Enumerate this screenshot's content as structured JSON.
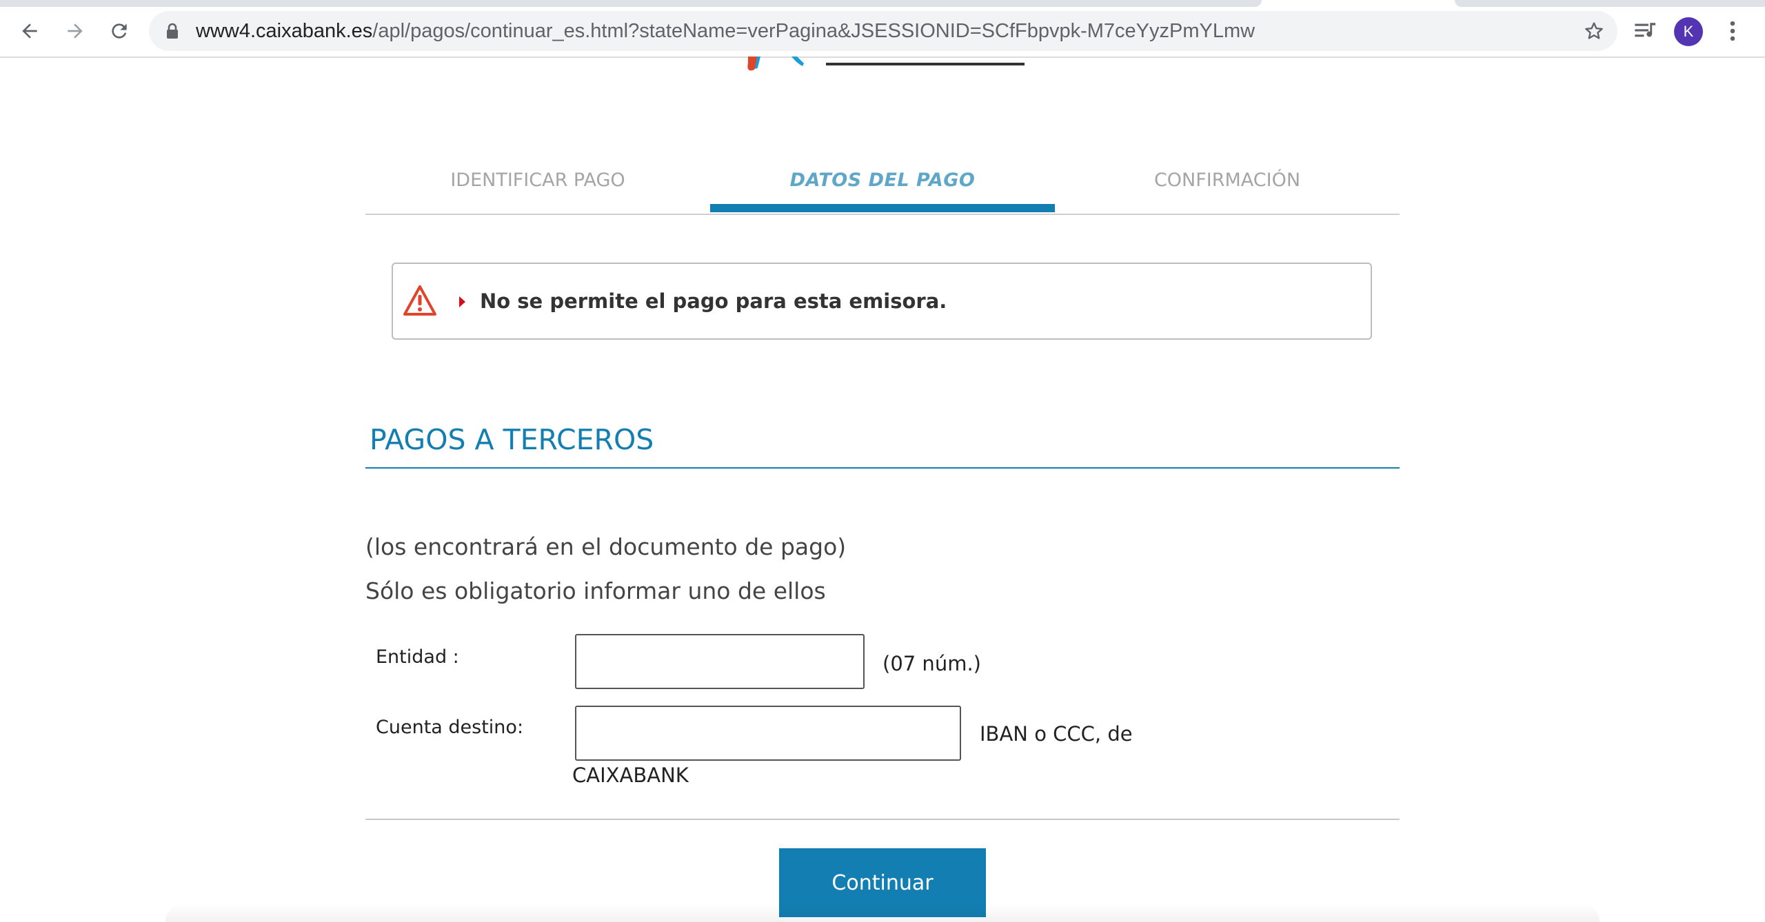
{
  "browser": {
    "url_host": "www4.caixabank.es",
    "url_path": "/apl/pagos/continuar_es.html?stateName=verPagina&JSESSIONID=SCfFbpvpk-M7ceYyzPmYLmw",
    "profile_initial": "K",
    "icons": [
      "back-arrow-icon",
      "forward-arrow-icon",
      "reload-icon",
      "lock-icon",
      "star-icon",
      "media-control-icon",
      "more-vertical-icon"
    ]
  },
  "steps": [
    {
      "label": "IDENTIFICAR PAGO",
      "active": false
    },
    {
      "label": "DATOS DEL PAGO",
      "active": true
    },
    {
      "label": "CONFIRMACIÓN",
      "active": false
    }
  ],
  "alert": {
    "message": "No se permite el pago para esta emisora.",
    "icon": "warning-triangle-icon"
  },
  "section": {
    "title": "PAGOS A TERCEROS"
  },
  "instructions": {
    "line1": "(los encontrará en el documento de pago)",
    "line2": "Sólo es obligatorio informar uno de ellos"
  },
  "form": {
    "entidad": {
      "label": "Entidad :",
      "value": "",
      "hint": "(07 núm.)"
    },
    "cuenta": {
      "label": "Cuenta destino:",
      "value": "",
      "hint_line1": "IBAN o CCC, de",
      "hint_line2": "CAIXABANK"
    }
  },
  "actions": {
    "continue_label": "Continuar"
  },
  "colors": {
    "brand_blue": "#137eb1",
    "active_step_text": "#5ea7c9",
    "alert_red": "#e0442b",
    "avatar": "#5335b3"
  }
}
